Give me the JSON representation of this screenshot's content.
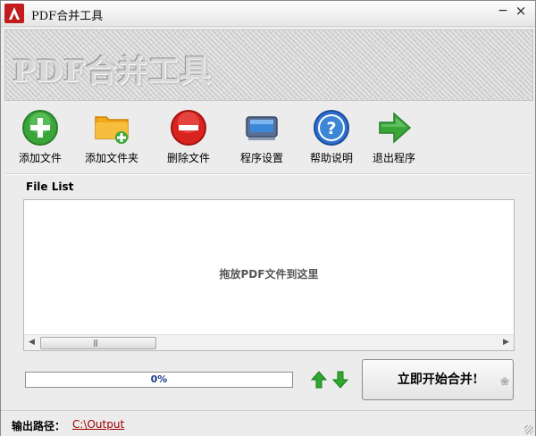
{
  "window": {
    "title": "PDF合并工具"
  },
  "banner": {
    "text": "PDF合并工具"
  },
  "toolbar": {
    "items": [
      {
        "label": "添加文件",
        "icon": "add-file-icon"
      },
      {
        "label": "添加文件夹",
        "icon": "add-folder-icon"
      },
      {
        "label": "删除文件",
        "icon": "delete-file-icon"
      },
      {
        "label": "程序设置",
        "icon": "settings-icon"
      },
      {
        "label": "帮助说明",
        "icon": "help-icon"
      },
      {
        "label": "退出程序",
        "icon": "exit-icon"
      }
    ]
  },
  "filelist": {
    "label": "File List",
    "hint": "拖放PDF文件到这里"
  },
  "progress": {
    "value": 0,
    "text": "0%"
  },
  "actions": {
    "merge_label": "立即开始合并!"
  },
  "status": {
    "label": "输出路径：",
    "path": "C:\\Output"
  },
  "colors": {
    "accent_red": "#c21d1d",
    "link": "#a00000",
    "progress_text": "#1d3b8a"
  }
}
